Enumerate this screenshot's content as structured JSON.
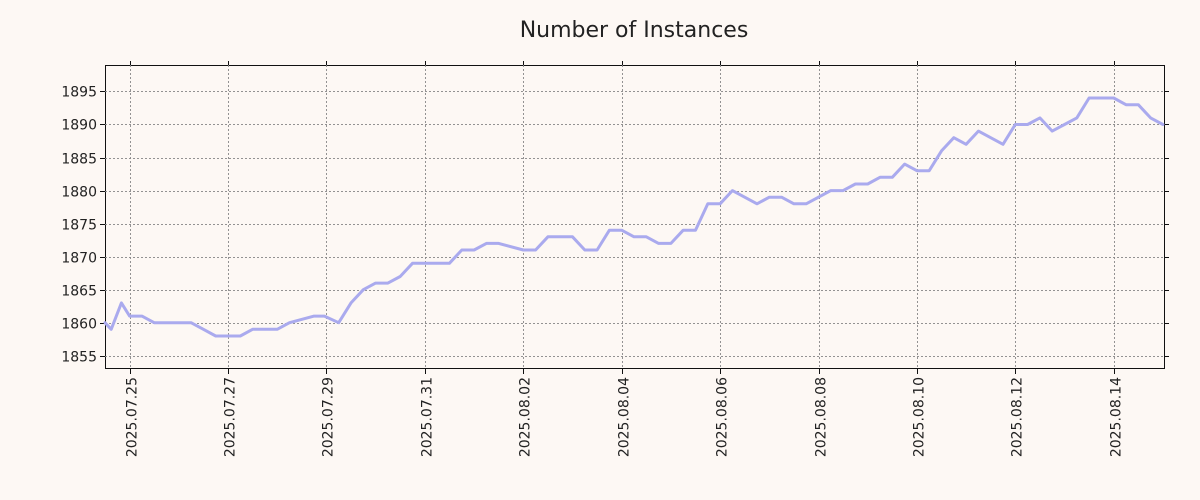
{
  "chart_data": {
    "type": "line",
    "title": "Number of Instances",
    "xlabel": "",
    "ylabel": "",
    "grid": true,
    "line_color": "#aaaaee",
    "background": "#fdf8f4",
    "x_ticks": [
      "2025.07.25",
      "2025.07.27",
      "2025.07.29",
      "2025.07.31",
      "2025.08.02",
      "2025.08.04",
      "2025.08.06",
      "2025.08.08",
      "2025.08.10",
      "2025.08.12",
      "2025.08.14"
    ],
    "xlim": [
      "2025.07.24 12:00",
      "2025.08.15 01:00"
    ],
    "y_ticks": [
      1855,
      1860,
      1865,
      1870,
      1875,
      1880,
      1885,
      1890,
      1895
    ],
    "ylim": [
      1853,
      1899
    ],
    "x": [
      "2025.07.24 12:00",
      "2025.07.24 15:00",
      "2025.07.24 20:00",
      "2025.07.25 00:00",
      "2025.07.25 06:00",
      "2025.07.25 12:00",
      "2025.07.25 18:00",
      "2025.07.26 06:00",
      "2025.07.26 12:00",
      "2025.07.26 18:00",
      "2025.07.26 21:00",
      "2025.07.27 00:00",
      "2025.07.27 06:00",
      "2025.07.27 12:00",
      "2025.07.27 18:00",
      "2025.07.28 00:00",
      "2025.07.28 06:00",
      "2025.07.28 18:00",
      "2025.07.28 23:00",
      "2025.07.29 06:00",
      "2025.07.29 12:00",
      "2025.07.29 18:00",
      "2025.07.30 00:00",
      "2025.07.30 06:00",
      "2025.07.30 12:00",
      "2025.07.30 18:00",
      "2025.07.31 06:00",
      "2025.07.31 12:00",
      "2025.07.31 18:00",
      "2025.08.01 00:00",
      "2025.08.01 06:00",
      "2025.08.01 12:00",
      "2025.08.02 00:00",
      "2025.08.02 06:00",
      "2025.08.02 12:00",
      "2025.08.02 18:00",
      "2025.08.03 00:00",
      "2025.08.03 06:00",
      "2025.08.03 12:00",
      "2025.08.03 18:00",
      "2025.08.04 00:00",
      "2025.08.04 06:00",
      "2025.08.04 12:00",
      "2025.08.04 18:00",
      "2025.08.05 00:00",
      "2025.08.05 06:00",
      "2025.08.05 12:00",
      "2025.08.05 18:00",
      "2025.08.06 00:00",
      "2025.08.06 06:00",
      "2025.08.06 12:00",
      "2025.08.06 18:00",
      "2025.08.07 00:00",
      "2025.08.07 06:00",
      "2025.08.07 12:00",
      "2025.08.07 18:00",
      "2025.08.08 00:00",
      "2025.08.08 06:00",
      "2025.08.08 12:00",
      "2025.08.08 18:00",
      "2025.08.09 00:00",
      "2025.08.09 06:00",
      "2025.08.09 12:00",
      "2025.08.09 18:00",
      "2025.08.10 00:00",
      "2025.08.10 06:00",
      "2025.08.10 12:00",
      "2025.08.10 18:00",
      "2025.08.11 00:00",
      "2025.08.11 06:00",
      "2025.08.11 12:00",
      "2025.08.11 18:00",
      "2025.08.12 00:00",
      "2025.08.12 06:00",
      "2025.08.12 12:00",
      "2025.08.12 18:00",
      "2025.08.13 00:00",
      "2025.08.13 06:00",
      "2025.08.13 12:00",
      "2025.08.13 18:00",
      "2025.08.14 00:00",
      "2025.08.14 06:00",
      "2025.08.14 12:00",
      "2025.08.14 18:00",
      "2025.08.15 00:00"
    ],
    "values": [
      1860,
      1859,
      1863,
      1861,
      1861,
      1860,
      1860,
      1860,
      1859,
      1858,
      1858,
      1858,
      1858,
      1859,
      1859,
      1859,
      1860,
      1861,
      1861,
      1860,
      1863,
      1865,
      1866,
      1866,
      1867,
      1869,
      1869,
      1869,
      1871,
      1871,
      1872,
      1872,
      1871,
      1871,
      1873,
      1873,
      1873,
      1871,
      1871,
      1874,
      1874,
      1873,
      1873,
      1872,
      1872,
      1874,
      1874,
      1878,
      1878,
      1880,
      1879,
      1878,
      1879,
      1879,
      1878,
      1878,
      1879,
      1880,
      1880,
      1881,
      1881,
      1882,
      1882,
      1884,
      1883,
      1883,
      1886,
      1888,
      1887,
      1889,
      1888,
      1887,
      1890,
      1890,
      1891,
      1889,
      1890,
      1891,
      1894,
      1894,
      1894,
      1893,
      1893,
      1891,
      1890
    ]
  }
}
